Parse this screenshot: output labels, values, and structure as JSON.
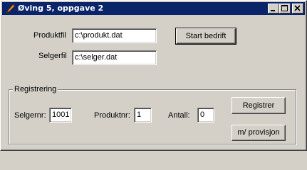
{
  "window": {
    "title": "Øving 5, oppgave 2",
    "icons": {
      "app": "pen-app-icon",
      "minimize": "minimize-icon",
      "maximize": "maximize-icon",
      "close": "close-icon"
    }
  },
  "files": {
    "produktfil_label": "Produktfil",
    "produktfil_value": "c:\\produkt.dat",
    "selgerfil_label": "Selgerfil",
    "selgerfil_value": "c:\\selger.dat",
    "start_button": "Start bedrift"
  },
  "registrering": {
    "group_label": "Registrering",
    "selgernr_label": "Selgernr:",
    "selgernr_value": "1001",
    "produktnr_label": "Produktnr:",
    "produktnr_value": "1",
    "antall_label": "Antall:",
    "antall_value": "0",
    "registrer_button": "Registrer",
    "provisjon_button": "m/ provisjon"
  },
  "colors": {
    "titlebar": "#0a246a",
    "face": "#d4d0c8"
  }
}
